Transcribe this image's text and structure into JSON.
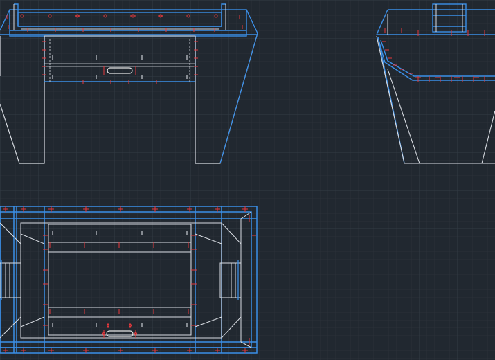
{
  "viewport": {
    "background": "#212830",
    "grid_minor_color": "#2b323b",
    "grid_major_color": "#343c47"
  },
  "colors": {
    "outline_blue": "#3b8fe8",
    "edge_white": "#d9dde3",
    "marker_red": "#e8383c",
    "slot_white": "#e6e6e6"
  },
  "views": [
    {
      "name": "front-elevation-view"
    },
    {
      "name": "side-elevation-view"
    },
    {
      "name": "top-plan-view"
    }
  ]
}
